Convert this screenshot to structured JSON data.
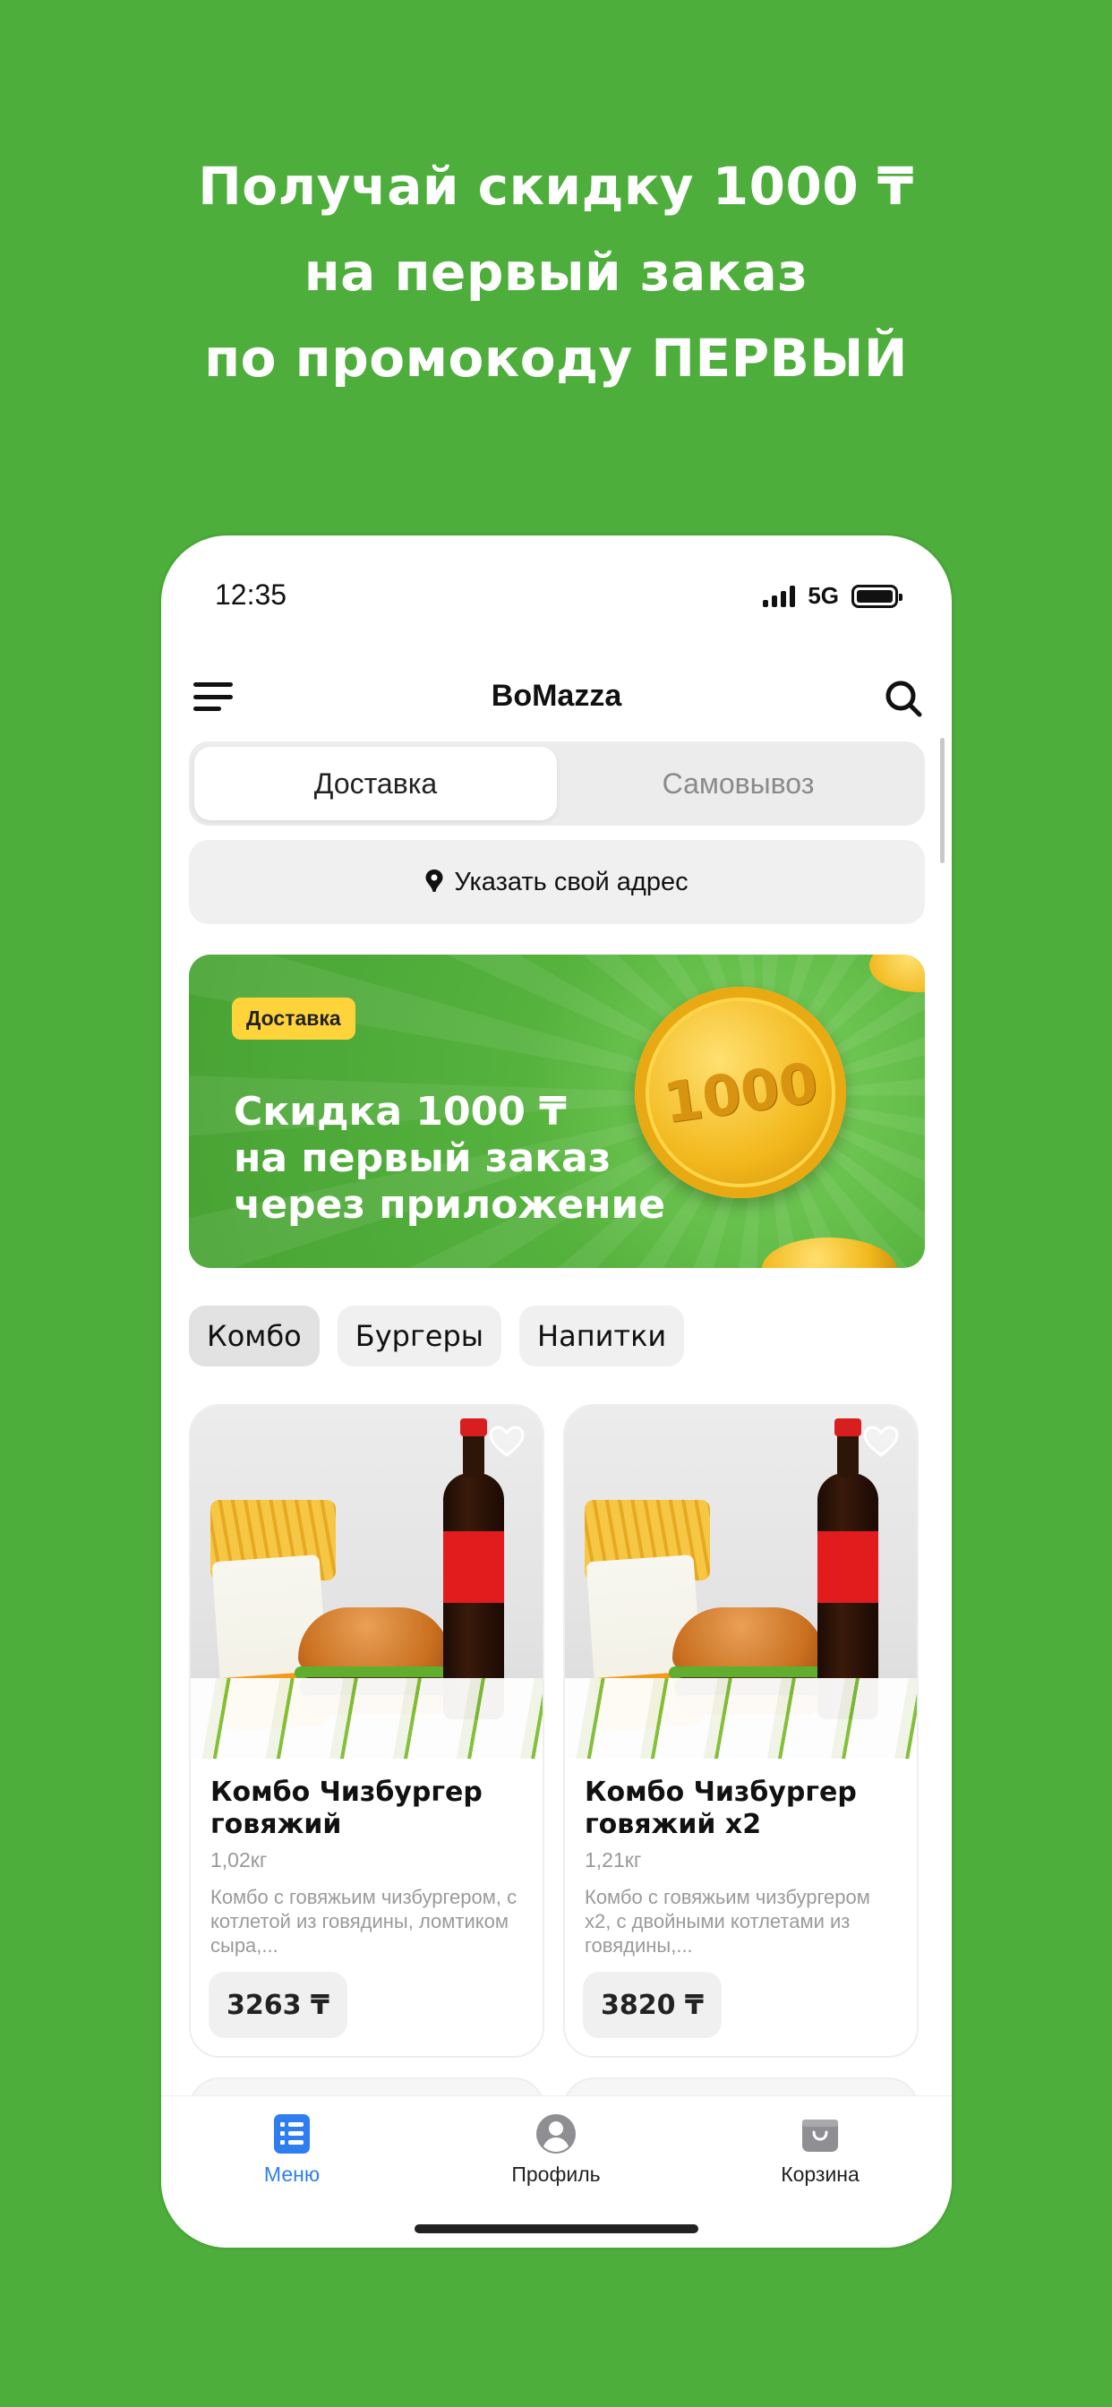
{
  "promo": {
    "line1": "Получай скидку 1000 ₸",
    "line2": "на первый заказ",
    "line3": "по промокоду ПЕРВЫЙ"
  },
  "status": {
    "time": "12:35",
    "network": "5G"
  },
  "appbar": {
    "title": "BoMazza",
    "menu_icon": "hamburger-icon",
    "search_icon": "search-icon"
  },
  "delivery_mode": {
    "options": [
      "Доставка",
      "Самовывоз"
    ],
    "selected": "Доставка"
  },
  "address": {
    "label": "Указать свой адрес",
    "icon": "location-pin-icon"
  },
  "banner": {
    "badge": "Доставка",
    "line1": "Скидка 1000 ₸",
    "line2": "на первый заказ",
    "line3": "через приложение",
    "coin_text": "1000"
  },
  "categories": {
    "items": [
      "Комбо",
      "Бургеры",
      "Напитки"
    ],
    "selected": "Комбо"
  },
  "products": [
    {
      "title": "Комбо Чизбургер говяжий",
      "weight": "1,02кг",
      "description": "Комбо с говяжьим чизбургером, с котлетой из говядины, ломтиком сыра,...",
      "price": "3263 ₸"
    },
    {
      "title": "Комбо Чизбургер говяжий x2",
      "weight": "1,21кг",
      "description": "Комбо с говяжьим чизбургером x2, с двойными котлетами из говядины,...",
      "price": "3820 ₸"
    }
  ],
  "tabbar": {
    "items": [
      {
        "label": "Меню",
        "icon": "menu-list-icon",
        "active": true
      },
      {
        "label": "Профиль",
        "icon": "profile-icon",
        "active": false
      },
      {
        "label": "Корзина",
        "icon": "cart-bag-icon",
        "active": false
      }
    ]
  },
  "colors": {
    "background": "#4dae3b",
    "accent_blue": "#2f7ef0",
    "badge_yellow": "#ffd43b"
  }
}
